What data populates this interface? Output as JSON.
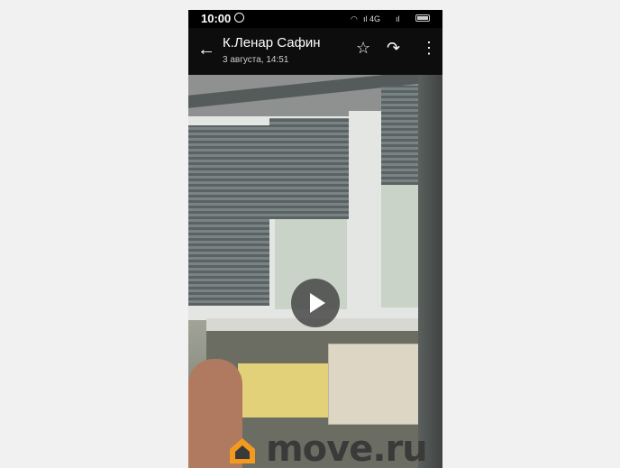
{
  "status_bar": {
    "time": "10:00",
    "signal_text_1": "ıl 4G",
    "signal_text_2": "ıl"
  },
  "app_bar": {
    "contact_name": "К.Ленар Сафин",
    "message_date": "3 августа, 14:51"
  },
  "icons": {
    "back": "arrow-left-icon",
    "star": "star-icon",
    "forward": "forward-icon",
    "menu": "more-vertical-icon",
    "play": "play-icon"
  },
  "watermark": {
    "text": "move.ru",
    "accent_color": "#f39a1e"
  },
  "colors": {
    "app_bar": "#0d0d0d",
    "background": "#f1f1f1"
  }
}
